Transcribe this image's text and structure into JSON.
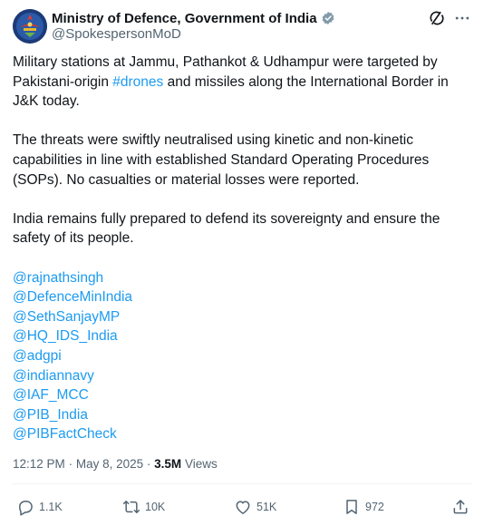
{
  "author": {
    "display_name": "Ministry of Defence, Government of India",
    "handle": "@SpokespersonMoD",
    "avatar_icon": "emblem-icon",
    "verified_icon": "verified-badge-icon",
    "verified_color": "#829aab"
  },
  "top_actions": [
    {
      "name": "grok-icon"
    },
    {
      "name": "more-icon"
    }
  ],
  "tweet": {
    "p1": {
      "before": "Military stations at Jammu, Pathankot & Udhampur were targeted by Pakistani-origin ",
      "hashtag": "#drones",
      "after": " and missiles along the International Border in J&K today."
    },
    "p2": "The threats were swiftly neutralised using kinetic and non-kinetic capabilities in line with established Standard Operating Procedures (SOPs). No casualties or material losses were reported.",
    "p3": "India remains fully prepared to defend its sovereignty and ensure the safety of its people.",
    "mentions": [
      "@rajnathsingh",
      "@DefenceMinIndia",
      "@SethSanjayMP",
      "@HQ_IDS_India",
      "@adgpi",
      "@indiannavy",
      "@IAF_MCC",
      "@PIB_India",
      "@PIBFactCheck"
    ]
  },
  "meta": {
    "time": "12:12 PM",
    "separator": "·",
    "date": "May 8, 2025",
    "views_count": "3.5M",
    "views_label": "Views"
  },
  "actions": {
    "replies": "1.1K",
    "reposts": "10K",
    "likes": "51K",
    "bookmarks": "972"
  },
  "colors": {
    "link": "#1d9bf0",
    "secondary_text": "#536471",
    "primary_text": "#0f1419"
  }
}
